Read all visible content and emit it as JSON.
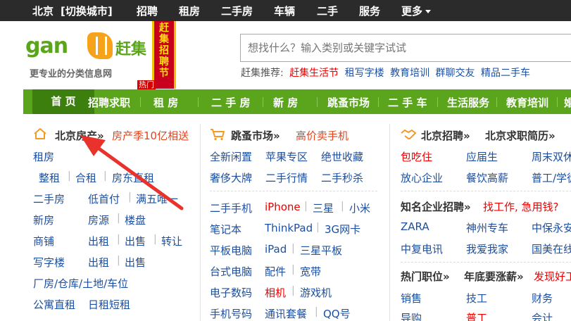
{
  "topbar": {
    "city": "北京",
    "switch_city": "[切换城市]",
    "items": [
      "招聘",
      "租房",
      "二手房",
      "车辆",
      "二手",
      "服务",
      "更多"
    ]
  },
  "header": {
    "logo_text": "gan",
    "logo_cn": "赶集",
    "slogan": "更专业的分类信息网",
    "ribbon": "赶集招聘节",
    "ribbon_tag": "热门",
    "search_placeholder": "想找什么？输入类别或关键字试试",
    "recommend_label": "赶集推荐:",
    "recommend_items": [
      "赶集生活节",
      "租写字楼",
      "教育培训",
      "群聊交友",
      "精品二手车"
    ]
  },
  "nav": {
    "items": [
      "首 页",
      "招聘求职",
      "租 房",
      "二 手 房",
      "新 房",
      "跳蚤市场",
      "二 手 车",
      "生活服务",
      "教育培训",
      "婚"
    ]
  },
  "col1": {
    "title": "北京房产»",
    "promo": "房产季10亿相送",
    "rows": [
      [
        "租房"
      ],
      [
        "整租",
        "合租",
        "房东直租"
      ],
      [
        "二手房",
        "低首付",
        "满五唯一"
      ],
      [
        "新房",
        "房源",
        "楼盘"
      ],
      [
        "商铺",
        "出租",
        "出售",
        "转让"
      ],
      [
        "写字楼",
        "出租",
        "出售"
      ],
      [
        "厂房/仓库/土地/车位"
      ],
      [
        "公寓直租",
        "日租短租"
      ]
    ]
  },
  "col2": {
    "title": "跳蚤市场»",
    "promo": "高价卖手机",
    "rows": [
      [
        "全新闲置",
        "苹果专区",
        "绝世收藏"
      ],
      [
        "奢侈大牌",
        "二手行情",
        "二手秒杀"
      ],
      [
        "二手手机",
        "iPhone",
        "三星",
        "小米"
      ],
      [
        "笔记本",
        "ThinkPad",
        "3G网卡"
      ],
      [
        "平板电脑",
        "iPad",
        "三星平板"
      ],
      [
        "台式电脑",
        "配件",
        "宽带"
      ],
      [
        "电子数码",
        "相机",
        "游戏机"
      ],
      [
        "手机号码",
        "通讯套餐",
        "QQ号"
      ]
    ]
  },
  "col3": {
    "title": "北京招聘»",
    "title2": "北京求职简历»",
    "rows": [
      [
        "包吃住",
        "应届生",
        "周末双休"
      ],
      [
        "放心企业",
        "餐饮高薪",
        "普工/学徒"
      ]
    ],
    "famous_title": "知名企业招聘»",
    "famous_promo": "找工作, 急用钱?",
    "famous_rows": [
      [
        "ZARA",
        "神州专车",
        "中保永安"
      ],
      [
        "中复电讯",
        "我爱我家",
        "国美在线"
      ]
    ],
    "hot_title": "热门职位»",
    "hot_title2": "年底要涨薪»",
    "hot_promo": "发现好工作",
    "hot_rows": [
      [
        "销售",
        "技工",
        "财务"
      ],
      [
        "导购",
        "普工",
        "会计"
      ]
    ]
  },
  "colors": {
    "brand_green": "#5aa51c",
    "nav_active": "#3d7f0e",
    "link_blue": "#1c4fa0",
    "promo_red": "#e3431b",
    "annotation_arrow": "#e8322b"
  }
}
